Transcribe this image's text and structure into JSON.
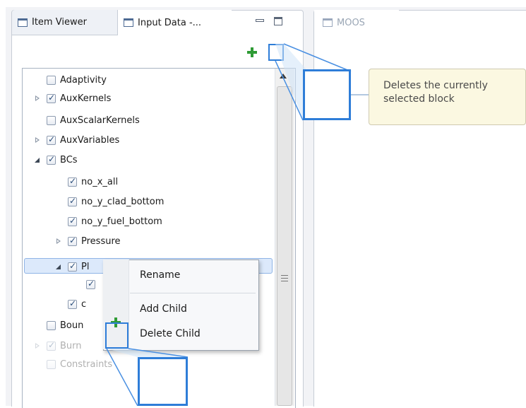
{
  "tabs": [
    {
      "label": "Item Viewer"
    },
    {
      "label": "Input Data -..."
    },
    {
      "label": "MOOS"
    }
  ],
  "tree": [
    {
      "label": "Adaptivity",
      "checked": false,
      "twisty": "none",
      "depth": 0
    },
    {
      "label": "AuxKernels",
      "checked": true,
      "twisty": "closed",
      "depth": 0
    },
    {
      "label": "AuxScalarKernels",
      "checked": false,
      "twisty": "none",
      "depth": 0
    },
    {
      "label": "AuxVariables",
      "checked": true,
      "twisty": "closed",
      "depth": 0
    },
    {
      "label": "BCs",
      "checked": true,
      "twisty": "open",
      "depth": 0
    },
    {
      "label": "no_x_all",
      "checked": true,
      "twisty": "none",
      "depth": 1
    },
    {
      "label": "no_y_clad_bottom",
      "checked": true,
      "twisty": "none",
      "depth": 1
    },
    {
      "label": "no_y_fuel_bottom",
      "checked": true,
      "twisty": "none",
      "depth": 1
    },
    {
      "label": "Pressure",
      "checked": true,
      "twisty": "closed",
      "depth": 1
    },
    {
      "label": "Pl",
      "checked": true,
      "twisty": "open",
      "depth": 1,
      "selected": true
    },
    {
      "label": "",
      "checked": true,
      "twisty": "none",
      "depth": 2
    },
    {
      "label": "c",
      "checked": true,
      "twisty": "none",
      "depth": 1
    },
    {
      "label": "Boun",
      "checked": false,
      "twisty": "none",
      "depth": 0
    },
    {
      "label": "Burn",
      "checked": true,
      "twisty": "closed",
      "depth": 0,
      "faded": true
    },
    {
      "label": "Constraints",
      "checked": false,
      "twisty": "none",
      "depth": 0,
      "faded": true
    }
  ],
  "context_menu": {
    "rename": "Rename",
    "add_child": "Add Child",
    "delete_child": "Delete Child"
  },
  "tooltip": {
    "line1": "Deletes the currently",
    "line2": "selected block"
  },
  "colors": {
    "highlight": "#2e7dd8",
    "add": "#2f9b35",
    "delete": "#d96156",
    "tooltip_bg": "#fbf8e1"
  }
}
